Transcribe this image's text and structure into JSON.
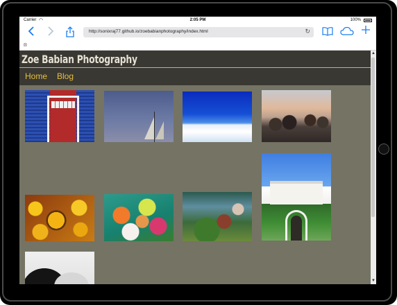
{
  "status_bar": {
    "carrier": "Carrier",
    "time": "2:05 PM",
    "battery": "100%"
  },
  "toolbar": {
    "url": "http://sonixraj77.github.io/zoebabianphotography/index.html"
  },
  "site": {
    "title": "Zoe Babian Photography",
    "nav": [
      "Home",
      "Blog"
    ]
  },
  "colors": {
    "page_background": "#757364",
    "header_background": "#3a3832",
    "nav_link": "#e6bf42",
    "browser_accent": "#1a7cf0"
  },
  "icons": {
    "back": "chevron-left-icon",
    "forward": "chevron-right-icon",
    "share": "share-icon",
    "reload": "reload-icon",
    "bookmarks": "book-icon",
    "cloud_tabs": "cloud-icon",
    "new_tab": "plus-icon",
    "close_tab": "close-icon",
    "wifi": "wifi-icon"
  },
  "gallery": [
    {
      "subject": "red door on blue clapboard house"
    },
    {
      "subject": "sailboat at dusk"
    },
    {
      "subject": "clouds under deep blue sky"
    },
    {
      "subject": "crowd at sunset"
    },
    {
      "subject": "white mansion with ivy"
    },
    {
      "subject": "sunflowers"
    },
    {
      "subject": "flower bouquet"
    },
    {
      "subject": "garden dinner scene"
    },
    {
      "subject": "black and white portrait"
    }
  ]
}
